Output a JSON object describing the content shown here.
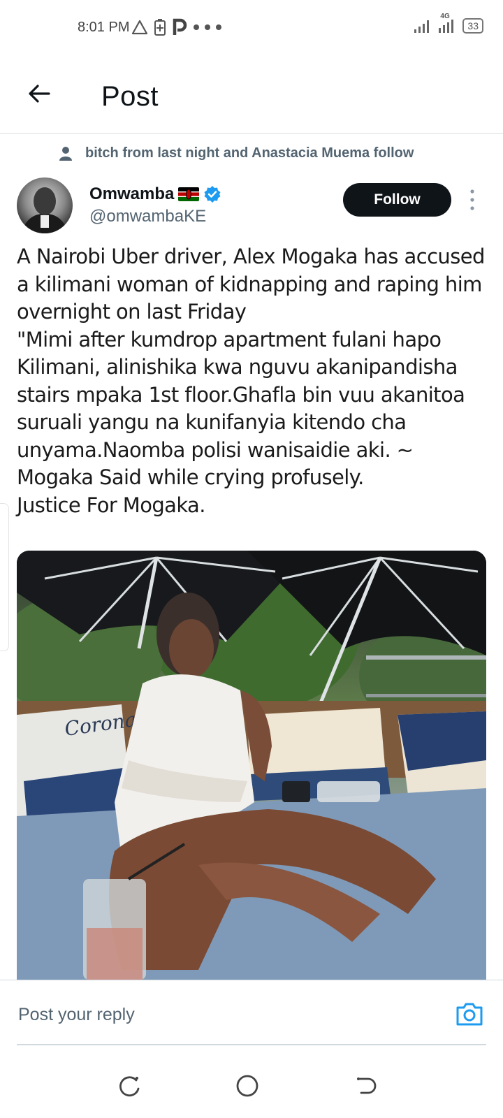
{
  "status_bar": {
    "time": "8:01 PM",
    "network": "4G",
    "battery": "33",
    "left_icons": [
      "alert-triangle-icon",
      "battery-saver-icon",
      "parking-p-icon",
      "more-dots-icon"
    ],
    "right_icons": [
      "signal-icon",
      "signal-4g-icon",
      "battery-icon"
    ]
  },
  "header": {
    "title": "Post",
    "back_icon": "arrow-left-icon"
  },
  "social_context": {
    "text": "bitch from last night and Anastacia Muema follow",
    "icon": "person-icon"
  },
  "author": {
    "name": "Omwamba",
    "handle": "@omwambaKE",
    "flag": "kenya-flag-icon",
    "verified": true,
    "follow_label": "Follow"
  },
  "tweet": {
    "text": "A Nairobi Uber driver, Alex Mogaka has accused a kilimani woman of kidnapping and raping him overnight on last Friday\n\"Mimi after kumdrop apartment fulani hapo Kilimani, alinishika kwa nguvu akanipandisha stairs mpaka 1st floor.Ghafla bin vuu akanitoa suruali yangu na kunifanyia kitendo cha unyama.Naomba polisi wanisaidie aki.  ~ Mogaka Said while crying profusely.\nJustice For Mogaka."
  },
  "media": {
    "pillow_text": "Corona"
  },
  "reply": {
    "placeholder": "Post your reply",
    "camera_icon": "camera-icon"
  },
  "nav_bar": {
    "buttons": [
      "recent-apps-icon",
      "home-icon",
      "back-icon"
    ]
  },
  "colors": {
    "accent": "#1d9bf0",
    "follow_bg": "#0f1419",
    "muted_text": "#536471"
  }
}
